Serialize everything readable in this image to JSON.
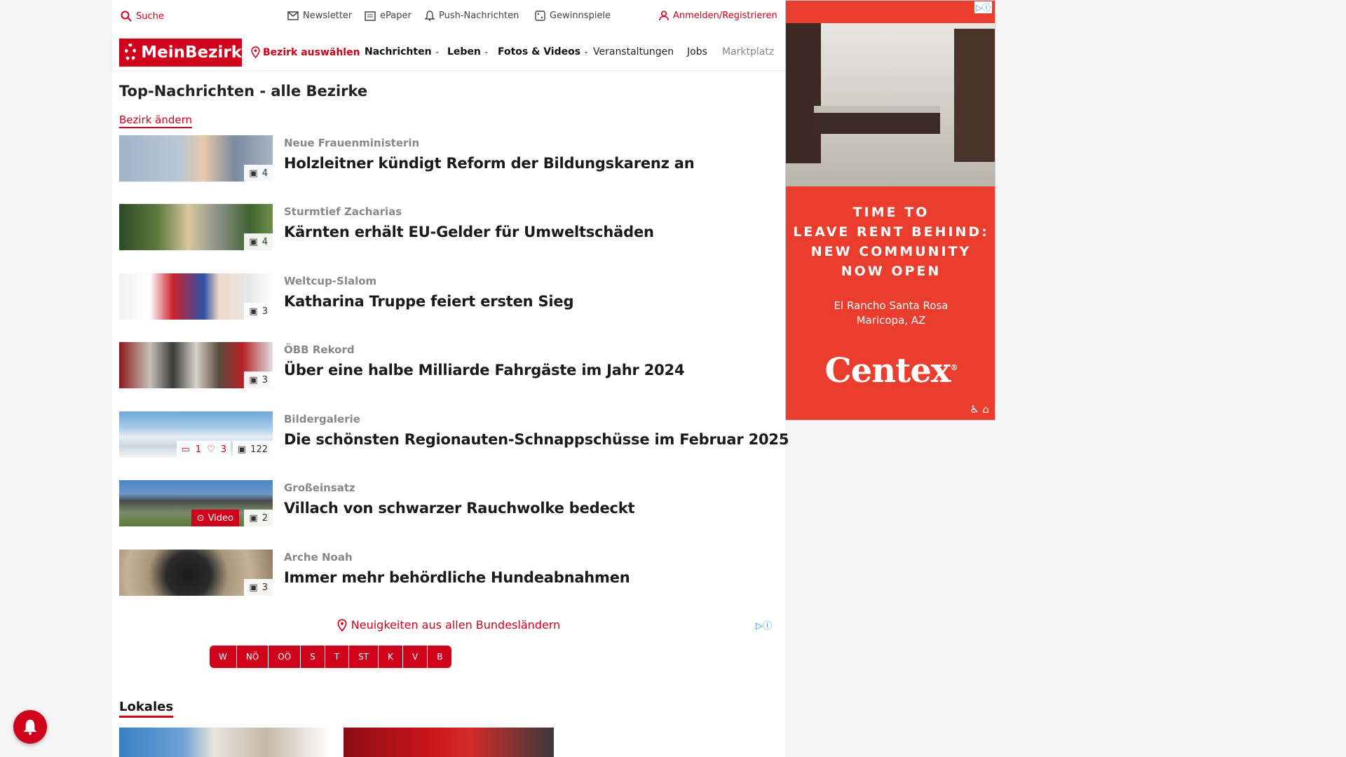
{
  "topbar": {
    "search": "Suche",
    "newsletter": "Newsletter",
    "epaper": "ePaper",
    "push": "Push-Nachrichten",
    "games": "Gewinnspiele",
    "login": "Anmelden/Registrieren"
  },
  "nav": {
    "logo": "MeinBezirk",
    "district": "Bezirk auswählen",
    "items": [
      "Nachrichten",
      "Leben",
      "Fotos & Videos",
      "Veranstaltungen",
      "Jobs",
      "Marktplatz"
    ]
  },
  "main": {
    "title": "Top-Nachrichten - alle Bezirke",
    "change_district": "Bezirk ändern",
    "articles": [
      {
        "kicker": "Neue Frauenministerin",
        "headline": "Holzleitner kündigt Reform der Bildungskarenz an",
        "images": "4"
      },
      {
        "kicker": "Sturmtief Zacharias",
        "headline": "Kärnten erhält EU-Gelder für Umweltschäden",
        "images": "4"
      },
      {
        "kicker": "Weltcup-Slalom",
        "headline": "Katharina Truppe feiert ersten Sieg",
        "images": "3"
      },
      {
        "kicker": "ÖBB Rekord",
        "headline": "Über eine halbe Milliarde Fahrgäste im Jahr 2024",
        "images": "3"
      },
      {
        "kicker": "Bildergalerie",
        "headline": "Die schönsten Regionauten-Schnappschüsse im Februar 2025",
        "images": "122",
        "comments": "1",
        "likes": "3"
      },
      {
        "kicker": "Großeinsatz",
        "headline": "Villach von schwarzer Rauchwolke bedeckt",
        "images": "2",
        "video": "Video"
      },
      {
        "kicker": "Arche Noah",
        "headline": "Immer mehr behördliche Hundeabnahmen",
        "images": "3"
      }
    ],
    "bundeslaender_title": "Neuigkeiten aus allen Bundesländern",
    "states": [
      "W",
      "NÖ",
      "OÖ",
      "S",
      "T",
      "ST",
      "K",
      "V",
      "B"
    ],
    "lokales": "Lokales"
  },
  "ad": {
    "slogan": [
      "TIME TO",
      "LEAVE RENT BEHIND:",
      "NEW COMMUNITY",
      "NOW OPEN"
    ],
    "location": [
      "El Rancho Santa Rosa",
      "Maricopa, AZ"
    ],
    "brand": "Centex"
  },
  "colors": {
    "accent": "#d0021b",
    "ad_red": "#eb3d2e"
  }
}
